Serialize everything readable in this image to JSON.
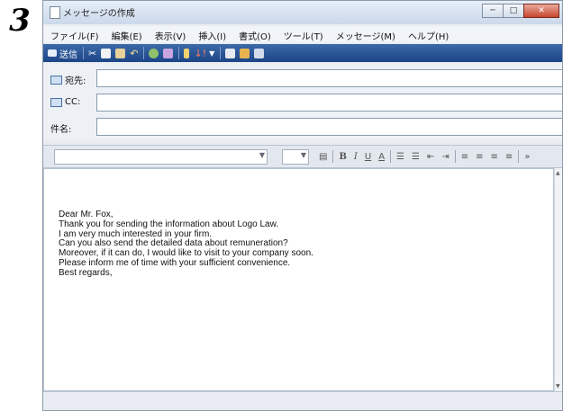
{
  "step_number": "3",
  "window": {
    "title": "メッセージの作成",
    "minimize_glyph": "─",
    "maximize_glyph": "□",
    "close_glyph": "✕"
  },
  "menu": [
    "ファイル(F)",
    "編集(E)",
    "表示(V)",
    "挿入(I)",
    "書式(O)",
    "ツール(T)",
    "メッセージ(M)",
    "ヘルプ(H)"
  ],
  "toolbar": {
    "send_label": "送信",
    "icons": [
      "cut-icon",
      "copy-icon",
      "paste-icon",
      "undo-icon",
      "check-names-icon",
      "spelling-icon",
      "attach-icon",
      "priority-icon",
      "sign-icon",
      "encrypt-icon",
      "offline-icon"
    ]
  },
  "header": {
    "to_label": "宛先:",
    "cc_label": "CC:",
    "subject_label": "件名:",
    "to_value": "",
    "cc_value": "",
    "subject_value": ""
  },
  "format": {
    "font_value": "",
    "size_value": "",
    "bold": "B",
    "italic": "I",
    "underline": "U",
    "color": "A",
    "more": "»"
  },
  "body_lines": [
    "Dear Mr. Fox,",
    "Thank you for sending the information about Logo Law.",
    "I am very much interested in your firm.",
    "Can you also send the detailed data about remuneration?",
    "Moreover, if it can do, I would like to visit to your company soon.",
    "Please inform me of time with your sufficient convenience.",
    "Best regards,"
  ],
  "colors": {
    "toolbar_bg": "#2a559a",
    "close_button": "#c8462f",
    "window_bg": "#e9edf3"
  }
}
